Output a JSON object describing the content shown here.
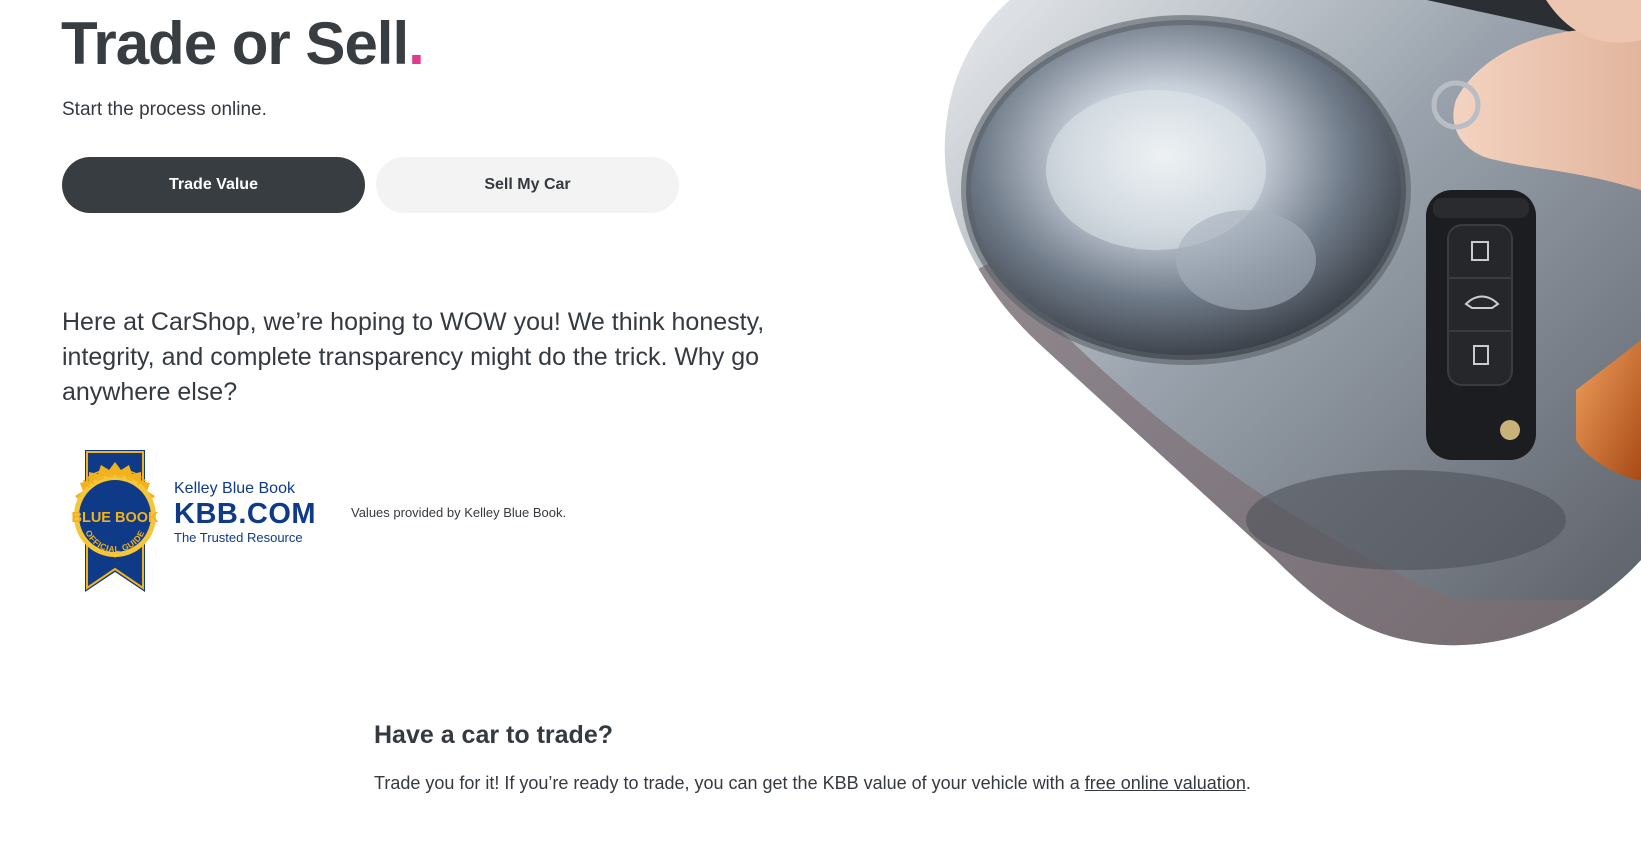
{
  "header": {
    "title": "Trade or Sell",
    "title_dot": ".",
    "subtitle": "Start the process online."
  },
  "buttons": {
    "trade_value": "Trade Value",
    "sell_my_car": "Sell My Car"
  },
  "intro": {
    "text": "Here at CarShop, we’re hoping to WOW you! We think honesty, integrity, and complete transparency might do the trick. Why go anywhere else?"
  },
  "kbb": {
    "badge_top": "KELLEY",
    "badge_middle": "BLUE BOOK",
    "badge_bottom": "OFFICIAL GUIDE",
    "name": "Kelley Blue Book",
    "domain": "KBB.COM",
    "tagline": "The Trusted Resource",
    "note": "Values provided by Kelley Blue Book."
  },
  "hero": {
    "icon": "car-key-photo"
  },
  "trade_section": {
    "heading": "Have a car to trade?",
    "text_before": "Trade you for it! If you’re ready to trade, you can get the KBB value of your vehicle with a ",
    "link": "free online valuation",
    "text_after": "."
  },
  "colors": {
    "accent_dot": "#e4398c",
    "dark_button": "#373d40",
    "light_button": "#f3f3f3",
    "kbb_blue": "#0f3a88",
    "kbb_gold": "#f2b21d"
  }
}
